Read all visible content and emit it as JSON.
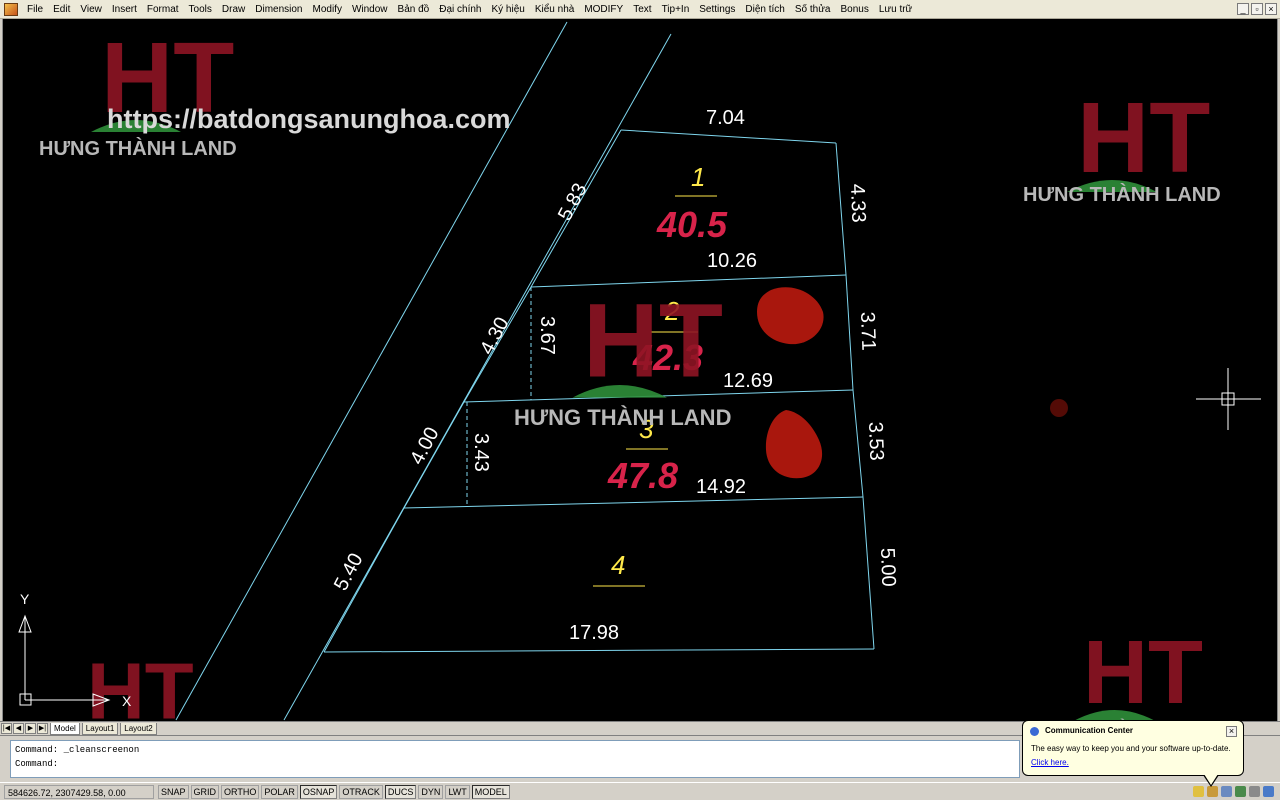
{
  "menu": [
    "File",
    "Edit",
    "View",
    "Insert",
    "Format",
    "Tools",
    "Draw",
    "Dimension",
    "Modify",
    "Window",
    "Bản đồ",
    "Đại chính",
    "Ký hiệu",
    "Kiểu nhà",
    "MODIFY",
    "Text",
    "Tip+In",
    "Settings",
    "Diện tích",
    "Số thửa",
    "Bonus",
    "Lưu trữ"
  ],
  "window_controls": [
    "_",
    "▫",
    "×"
  ],
  "drawing": {
    "watermark_url": "https://batdongsanunghoa.com",
    "brand": "HƯNG THÀNH LAND",
    "logo_letters": "HT",
    "colors": {
      "lines": "#7fd6ee",
      "dims": "#ffffff",
      "lot_number": "#ffe94a",
      "area": "#d8234a",
      "logo": "#8e1424",
      "logo_leaf": "#2f8f3a",
      "brand_text": "#b8b8b8",
      "blob": "#c81c10"
    },
    "lots": [
      {
        "number": "1",
        "area": "40.5"
      },
      {
        "number": "2",
        "area": "42.3"
      },
      {
        "number": "3",
        "area": "47.8"
      },
      {
        "number": "4",
        "area": ""
      }
    ],
    "dimensions": {
      "top": "7.04",
      "left_1": "5.83",
      "right_1": "4.33",
      "div_1_2": "10.26",
      "left_2": "4.30",
      "inner_2": "3.67",
      "right_2": "3.71",
      "div_2_3": "12.69",
      "left_3": "4.00",
      "inner_3": "3.43",
      "right_3": "3.53",
      "div_3_4": "14.92",
      "left_4": "5.40",
      "right_4": "5.00",
      "bottom": "17.98"
    },
    "ucs_labels": {
      "y": "Y",
      "x": "X"
    }
  },
  "layout_tabs": [
    "Model",
    "Layout1",
    "Layout2"
  ],
  "command_history": [
    "Command: _cleanscreenon"
  ],
  "command_prompt": "Command:",
  "status": {
    "coords": "584626.72, 2307429.58, 0.00",
    "modes": [
      "SNAP",
      "GRID",
      "ORTHO",
      "POLAR",
      "OSNAP",
      "OTRACK",
      "DUCS",
      "DYN",
      "LWT",
      "MODEL"
    ],
    "modes_on": [
      "OSNAP",
      "DUCS",
      "MODEL"
    ]
  },
  "balloon": {
    "title": "Communication Center",
    "text": "The easy way to keep you and your software up-to-date.",
    "link": "Click here."
  }
}
